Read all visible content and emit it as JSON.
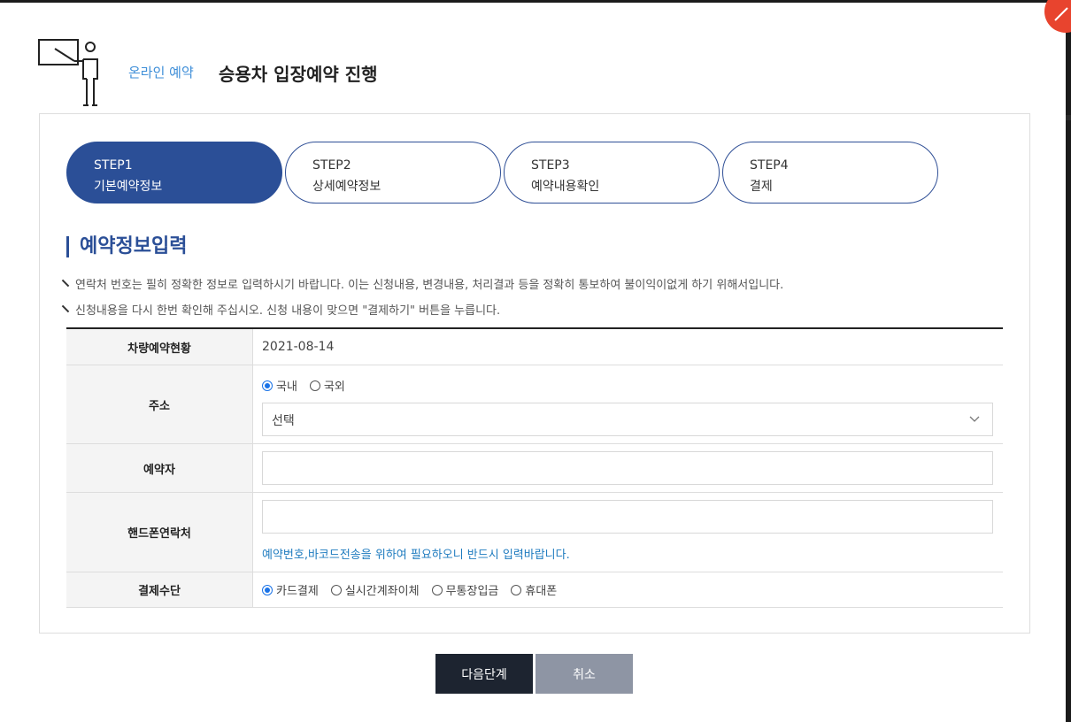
{
  "header": {
    "subtitle": "온라인 예약",
    "title": "승용차 입장예약 진행"
  },
  "steps": [
    {
      "num": "STEP1",
      "label": "기본예약정보",
      "active": true
    },
    {
      "num": "STEP2",
      "label": "상세예약정보",
      "active": false
    },
    {
      "num": "STEP3",
      "label": "예약내용확인",
      "active": false
    },
    {
      "num": "STEP4",
      "label": "결제",
      "active": false
    }
  ],
  "section": {
    "title": "예약정보입력",
    "notes": [
      "연락처 번호는 필히 정확한 정보로 입력하시기 바랍니다. 이는 신청내용, 변경내용, 처리결과 등을 정확히 통보하여 불이익이없게 하기 위해서입니다.",
      "신청내용을 다시 한번 확인해 주십시오. 신청 내용이 맞으면 \"결제하기\" 버튼을 누릅니다."
    ]
  },
  "form": {
    "date_label": "차량예약현황",
    "date_value": "2021-08-14",
    "address_label": "주소",
    "address_options": [
      "국내",
      "국외"
    ],
    "address_select": "선택",
    "reserver_label": "예약자",
    "phone_label": "핸드폰연락처",
    "phone_help": "예약번호,바코드전송을 위하여 필요하오니 반드시 입력바랍니다.",
    "payment_label": "결제수단",
    "payment_options": [
      "카드결제",
      "실시간계좌이체",
      "무통장입금",
      "휴대폰"
    ]
  },
  "buttons": {
    "next": "다음단계",
    "cancel": "취소"
  },
  "colors": {
    "primary": "#2b4f97",
    "link": "#1e7bbf",
    "close": "#e8442e"
  }
}
